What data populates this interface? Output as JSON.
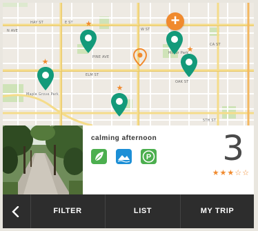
{
  "map": {
    "street_labels": [
      "N AVE",
      "HAY ST",
      "E ST",
      "W ST",
      "CA ST",
      "Mirror Park",
      "Maple Grove Park",
      "ELM ST",
      "OAK ST",
      "PINE AVE",
      "5TH ST"
    ],
    "add_button_symbol": "+",
    "pins": [
      {
        "name": "park-pin",
        "color": "#139a7a",
        "starred": true
      },
      {
        "name": "park-pin",
        "color": "#139a7a",
        "starred": false
      },
      {
        "name": "park-pin",
        "color": "#139a7a",
        "starred": true
      },
      {
        "name": "park-pin",
        "color": "#139a7a",
        "starred": true
      },
      {
        "name": "park-pin",
        "color": "#139a7a",
        "starred": true
      }
    ],
    "star_marker_symbol": "★",
    "location_marker_color": "#f08a2e"
  },
  "place": {
    "name": "calming afternoon",
    "amenities": [
      {
        "icon": "leaf-icon",
        "color": "#4caf4f"
      },
      {
        "icon": "water-icon",
        "color": "#1c8fd6"
      },
      {
        "icon": "parking-icon",
        "color": "#4caf4f",
        "letter": "P"
      }
    ],
    "rating": "3",
    "rating_value": 3,
    "rating_max": 5,
    "stars_text": "★★★☆☆"
  },
  "nav": {
    "back_icon": "chevron-left-icon",
    "filter": "FILTER",
    "list": "LIST",
    "my_trip": "MY TRIP"
  },
  "colors": {
    "accent": "#f08a2e",
    "pin": "#139a7a",
    "bar": "#2d2d2d"
  }
}
